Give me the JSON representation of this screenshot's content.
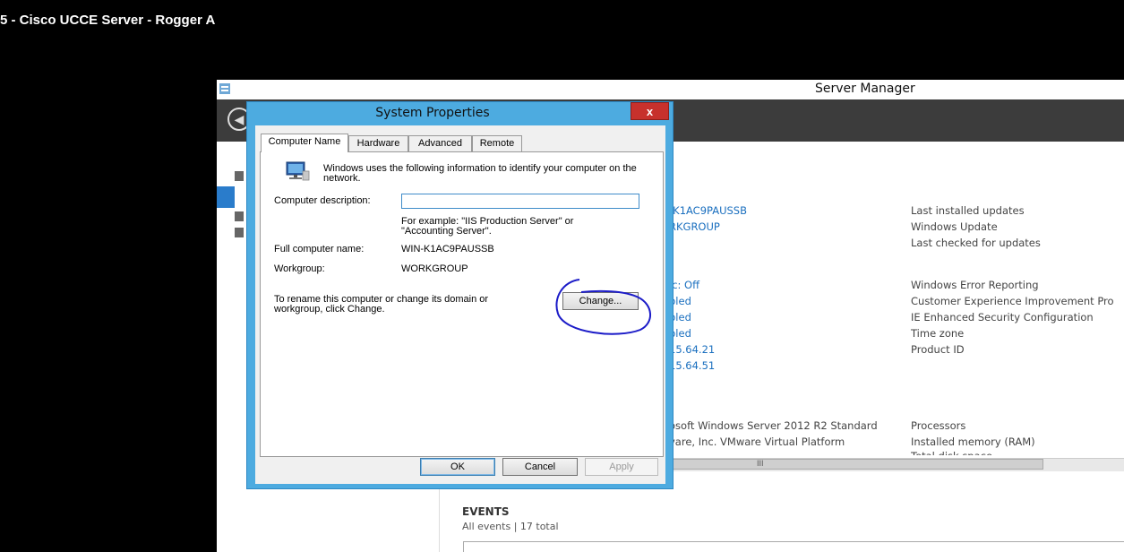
{
  "vm_title": "5 - Cisco UCCE Server - Rogger A",
  "server_manager": {
    "title": "Server Manager",
    "col1": [
      {
        "text": "-K1AC9PAUSSB",
        "color": "#1a6fbf"
      },
      {
        "text": "RKGROUP",
        "color": "#1a6fbf"
      },
      {
        "text": "ic: Off",
        "color": "#1a6fbf"
      },
      {
        "text": "bled",
        "color": "#1a6fbf"
      },
      {
        "text": "bled",
        "color": "#1a6fbf"
      },
      {
        "text": "bled",
        "color": "#1a6fbf"
      },
      {
        "text": "15.64.21",
        "color": "#1a6fbf"
      },
      {
        "text": "15.64.51",
        "color": "#1a6fbf"
      },
      {
        "text": "osoft Windows Server 2012 R2 Standard",
        "color": "#444"
      },
      {
        "text": "vare, Inc. VMware Virtual Platform",
        "color": "#444"
      }
    ],
    "col2": [
      "Last installed updates",
      "Windows Update",
      "Last checked for updates",
      "Windows Error Reporting",
      "Customer Experience Improvement Pro",
      "IE Enhanced Security Configuration",
      "Time zone",
      "Product ID",
      "Processors",
      "Installed memory (RAM)",
      "Total disk space"
    ],
    "scroll_grip": "III",
    "events": {
      "title": "EVENTS",
      "subtitle": "All events | 17 total"
    }
  },
  "dialog": {
    "title": "System Properties",
    "close": "x",
    "tabs": [
      "Computer Name",
      "Hardware",
      "Advanced",
      "Remote"
    ],
    "intro": "Windows uses the following information to identify your computer on the network.",
    "desc_label": "Computer description:",
    "desc_value": "",
    "example_line1": "For example: \"IIS Production Server\" or",
    "example_line2": "\"Accounting Server\".",
    "full_name_label": "Full computer name:",
    "full_name_value": "WIN-K1AC9PAUSSB",
    "workgroup_label": "Workgroup:",
    "workgroup_value": "WORKGROUP",
    "rename_line1": "To rename this computer or change its domain or",
    "rename_line2": "workgroup, click Change.",
    "change_button": "Change...",
    "ok_button": "OK",
    "cancel_button": "Cancel",
    "apply_button": "Apply"
  },
  "annotation_color": "#1c1cc8"
}
